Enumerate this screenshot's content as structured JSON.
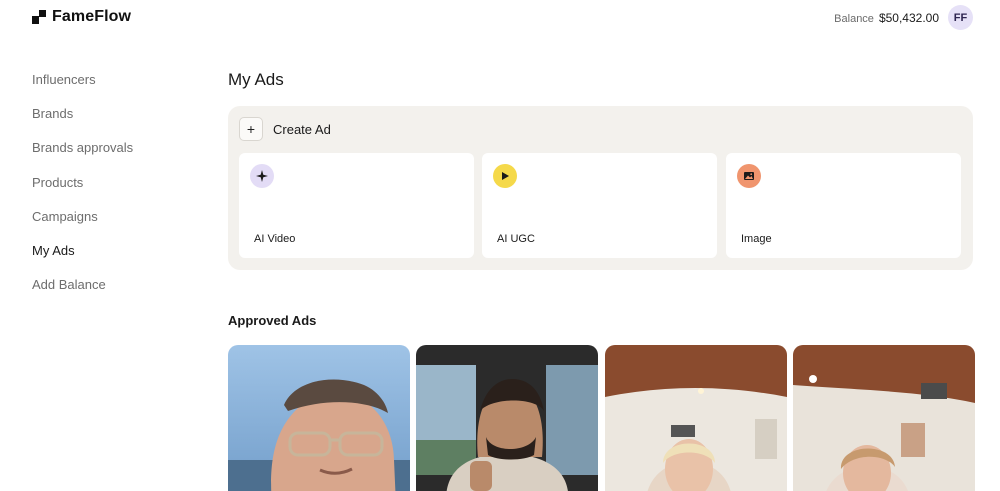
{
  "brand": {
    "name": "FameFlow"
  },
  "header": {
    "balance_label": "Balance",
    "balance_value": "$50,432.00",
    "avatar_initials": "FF"
  },
  "sidebar": {
    "items": [
      {
        "label": "Influencers",
        "active": false
      },
      {
        "label": "Brands",
        "active": false
      },
      {
        "label": "Brands approvals",
        "active": false
      },
      {
        "label": "Products",
        "active": false
      },
      {
        "label": "Campaigns",
        "active": false
      },
      {
        "label": "My Ads",
        "active": true
      },
      {
        "label": "Add Balance",
        "active": false
      }
    ]
  },
  "main": {
    "title": "My Ads",
    "create": {
      "label": "Create Ad",
      "types": [
        {
          "label": "AI Video",
          "icon": "sparkle-icon",
          "color": "#e3dcf6"
        },
        {
          "label": "AI UGC",
          "icon": "play-icon",
          "color": "#f5d94a"
        },
        {
          "label": "Image",
          "icon": "image-icon",
          "color": "#f0956e"
        }
      ]
    },
    "approved": {
      "title": "Approved Ads",
      "thumbnails": [
        {
          "icon": "video-thumbnail-man-beach"
        },
        {
          "icon": "video-thumbnail-man-car"
        },
        {
          "icon": "video-thumbnail-woman-room"
        },
        {
          "icon": "video-thumbnail-woman-room-2"
        }
      ]
    }
  }
}
